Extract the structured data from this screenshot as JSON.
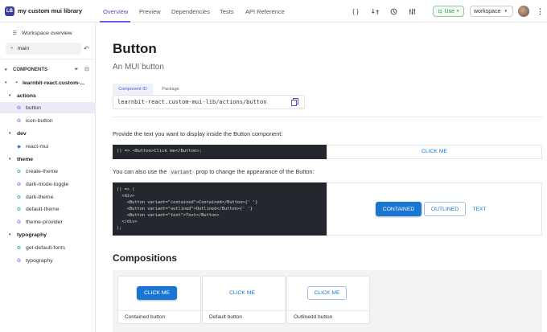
{
  "topbar": {
    "logo": "LB",
    "library_title": "my custom mui library",
    "tabs": [
      "Overview",
      "Preview",
      "Dependencies",
      "Tests",
      "API Reference"
    ],
    "use_label": "Use",
    "workspace_label": "workspace"
  },
  "sidebar": {
    "workspace_overview": "Workspace overview",
    "branch": "main",
    "components_header": "COMPONENTS",
    "scope": "learnbit-react.custom-...",
    "groups": [
      {
        "name": "actions",
        "items": [
          "button",
          "icon-button"
        ]
      },
      {
        "name": "dev",
        "items": [
          "react-mui"
        ]
      },
      {
        "name": "theme",
        "items": [
          "create-theme",
          "dark-mode-toggle",
          "dark-theme",
          "default-theme",
          "theme-provider"
        ]
      },
      {
        "name": "typography",
        "items": [
          "get-default-fonts",
          "typography"
        ]
      }
    ]
  },
  "main": {
    "title": "Button",
    "subtitle": "An MUI button",
    "id_tabs": [
      "Component ID",
      "Package"
    ],
    "component_id": "learnbit-react.custom-mui-lib/actions/button",
    "para1": "Provide the text you want to display inside the Button component:",
    "code1": "() => <Button>Click me</Button>;",
    "preview1_label": "CLICK ME",
    "para2_before": "You can also use the",
    "para2_code": "variant",
    "para2_after": "prop to change the appearance of the Button:",
    "code2": "() => (\n  <div>\n    <Button variant=\"contained\">Contained</Button>{' '}\n    <Button variant=\"outlined\">Outlined</Button>{' '}\n    <Button variant=\"text\">Text</Button>\n  </div>\n);",
    "variant_buttons": [
      "CONTAINED",
      "OUTLINED",
      "TEXT"
    ],
    "compositions_title": "Compositions",
    "compositions": [
      {
        "button": "CLICK ME",
        "label": "Contained button"
      },
      {
        "button": "CLICK ME",
        "label": "Default button"
      },
      {
        "button": "CLICK ME",
        "label": "Outlinedd button"
      }
    ]
  },
  "colors": {
    "accent": "#6c5ce7",
    "mui_primary": "#1976d2",
    "code_bg": "#24272e",
    "use_green": "#2f8f46"
  }
}
